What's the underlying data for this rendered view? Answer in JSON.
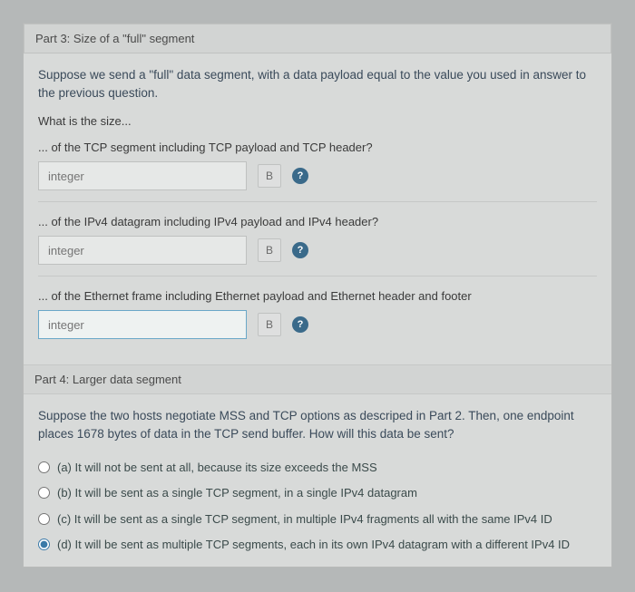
{
  "part3": {
    "title": "Part 3: Size of a \"full\" segment",
    "intro": "Suppose we send a \"full\" data segment, with a data payload equal to the value you used in answer to the previous question.",
    "prompt_lead": "What is the size...",
    "q1": {
      "text": "... of the TCP segment including TCP payload and TCP header?",
      "placeholder": "integer",
      "unit": "B"
    },
    "q2": {
      "text": "... of the IPv4 datagram including IPv4 payload and IPv4 header?",
      "placeholder": "integer",
      "unit": "B"
    },
    "q3": {
      "text": "... of the Ethernet frame including Ethernet payload and Ethernet header and footer",
      "placeholder": "integer",
      "unit": "B"
    }
  },
  "part4": {
    "title": "Part 4: Larger data segment",
    "intro": "Suppose the two hosts negotiate MSS and TCP options as descriped in Part 2. Then, one endpoint places 1678 bytes of data in the TCP send buffer. How will this data be sent?",
    "options": {
      "a": "(a) It will not be sent at all, because its size exceeds the MSS",
      "b": "(b) It will be sent as a single TCP segment, in a single IPv4 datagram",
      "c": "(c) It will be sent as a single TCP segment, in multiple IPv4 fragments all with the same IPv4 ID",
      "d": "(d) It will be sent as multiple TCP segments, each in its own IPv4 datagram with a different IPv4 ID"
    },
    "selected": "d"
  },
  "help_glyph": "?"
}
